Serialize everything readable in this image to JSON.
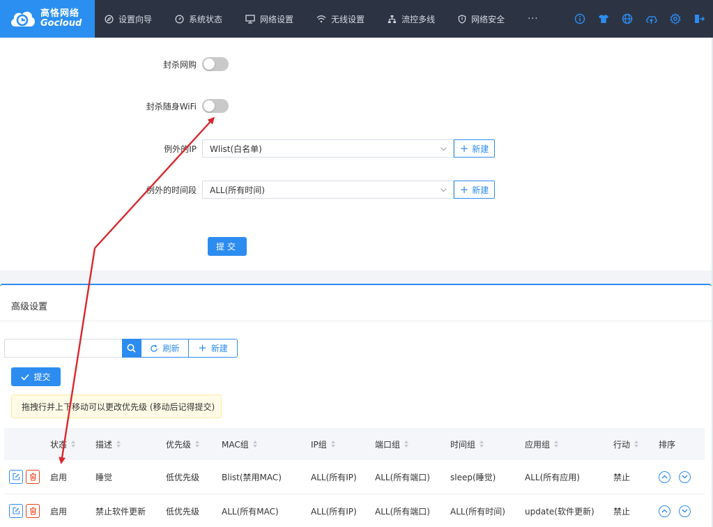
{
  "brand": {
    "cn": "高恪网络",
    "en": "Gocloud"
  },
  "nav": [
    {
      "label": "设置向导",
      "icon": "compass-icon"
    },
    {
      "label": "系统状态",
      "icon": "dashboard-icon"
    },
    {
      "label": "网络设置",
      "icon": "monitor-icon"
    },
    {
      "label": "无线设置",
      "icon": "wifi-icon"
    },
    {
      "label": "流控多线",
      "icon": "network-icon"
    },
    {
      "label": "网络安全",
      "icon": "shield-icon"
    }
  ],
  "nav_more": "···",
  "toolbar_icons": [
    "info-icon",
    "tshirt-icon",
    "globe-icon",
    "cloud-upload-icon",
    "gear-icon",
    "logout-icon"
  ],
  "form": {
    "block_shopping_label": "封杀网购",
    "block_portable_wifi_label": "封杀随身WiFi",
    "exception_ip_label": "例外的IP",
    "exception_ip_value": "Wlist(白名单)",
    "exception_time_label": "例外的时间段",
    "exception_time_value": "ALL(所有时间)",
    "new_label": "新建",
    "submit_label": "提交"
  },
  "advanced": {
    "title": "高级设置",
    "search_value": "",
    "refresh_label": "刷新",
    "new_label": "新建",
    "submit_label": "提交",
    "notice": "拖拽行并上下移动可以更改优先级 (移动后记得提交)",
    "columns": [
      "状态",
      "描述",
      "优先级",
      "MAC组",
      "IP组",
      "端口组",
      "时间组",
      "应用组",
      "行动",
      "排序"
    ],
    "rows": [
      {
        "status": "启用",
        "desc": "睡觉",
        "priority": "低优先级",
        "mac": "Blist(禁用MAC)",
        "ip": "ALL(所有IP)",
        "port": "ALL(所有端口)",
        "time": "sleep(睡觉)",
        "app": "ALL(所有应用)",
        "action": "禁止"
      },
      {
        "status": "启用",
        "desc": "禁止软件更新",
        "priority": "低优先级",
        "mac": "ALL(所有MAC)",
        "ip": "ALL(所有IP)",
        "port": "ALL(所有端口)",
        "time": "ALL(所有时间)",
        "app": "update(软件更新)",
        "action": "禁止"
      }
    ]
  },
  "colors": {
    "primary": "#2d8cf0",
    "topbar": "#2c3444",
    "logo_bg": "#2a8ff0",
    "danger": "#ed4014",
    "annotation": "#d9262b"
  }
}
